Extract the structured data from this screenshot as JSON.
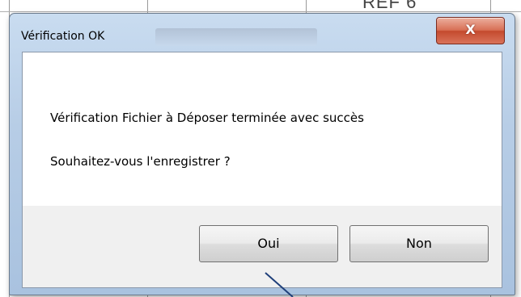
{
  "background": {
    "partial_text": "REF 6"
  },
  "dialog": {
    "title": "Vérification OK",
    "close_icon": "X",
    "message_line1": "Vérification Fichier à Déposer terminée avec succès",
    "message_line2": "Souhaitez-vous l'enregistrer ?",
    "buttons": {
      "yes": "Oui",
      "no": "Non"
    }
  },
  "colors": {
    "close_button": "#d86f55",
    "titlebar": "#b7cde6",
    "pointer_line": "#1f3f7a"
  }
}
